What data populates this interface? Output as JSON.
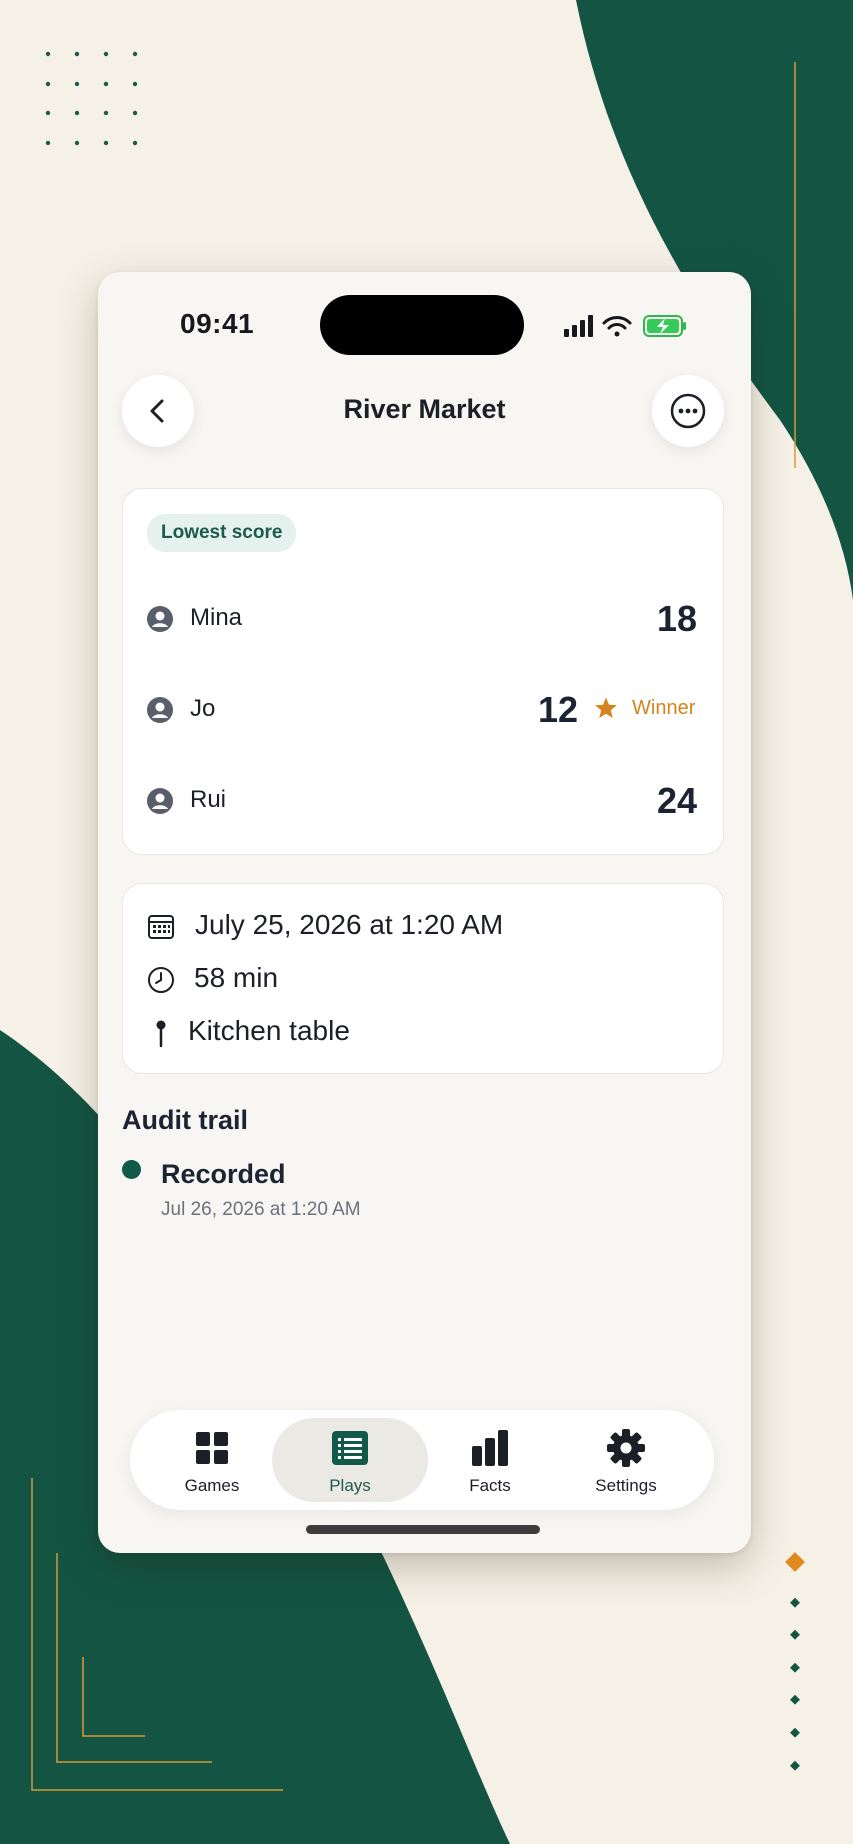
{
  "colors": {
    "accent": "#115949",
    "winner": "#d4841c",
    "background": "#f6f1e6"
  },
  "status_bar": {
    "time": "09:41",
    "icons": [
      "signal-icon",
      "wifi-icon",
      "battery-charging-icon"
    ]
  },
  "header": {
    "title": "River Market",
    "back_icon": "chevron-left-icon",
    "more_icon": "ellipsis-circle-icon"
  },
  "scores": {
    "badge": "Lowest score",
    "players": [
      {
        "name": "Mina",
        "score": "18",
        "winner": false
      },
      {
        "name": "Jo",
        "score": "12",
        "winner": true
      },
      {
        "name": "Rui",
        "score": "24",
        "winner": false
      }
    ],
    "winner_label": "Winner"
  },
  "details": {
    "date": "July 25, 2026 at 1:20 AM",
    "duration": "58 min",
    "location": "Kitchen table"
  },
  "audit": {
    "title": "Audit trail",
    "events": [
      {
        "title": "Recorded",
        "time": "Jul 26, 2026 at 1:20 AM"
      }
    ]
  },
  "tabs": [
    {
      "label": "Games",
      "icon": "grid-icon",
      "active": false
    },
    {
      "label": "Plays",
      "icon": "list-icon",
      "active": true
    },
    {
      "label": "Facts",
      "icon": "bar-chart-icon",
      "active": false
    },
    {
      "label": "Settings",
      "icon": "gear-icon",
      "active": false
    }
  ]
}
